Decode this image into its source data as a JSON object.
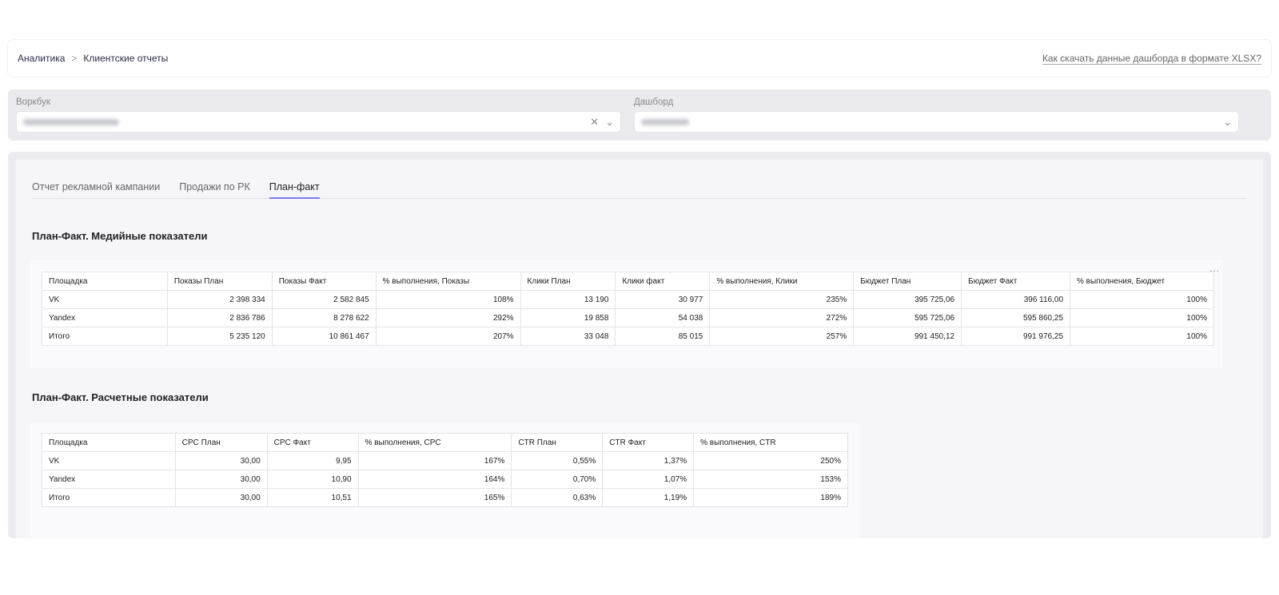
{
  "breadcrumb": {
    "items": [
      "Аналитика",
      "Клиентские отчеты"
    ],
    "separator": ">"
  },
  "help_link": "Как скачать данные дашборда в формате XLSX?",
  "filters": {
    "workbook_label": "Воркбук",
    "dashboard_label": "Дашборд"
  },
  "tabs": [
    "Отчет рекламной кампании",
    "Продажи по РК",
    "План-факт"
  ],
  "section1": {
    "title": "План-Факт. Медийные показатели",
    "headers": [
      "Площадка",
      "Показы План",
      "Показы Факт",
      "% выполнения, Показы",
      "Клики План",
      "Клики факт",
      "% выполнения, Клики",
      "Бюджет План",
      "Бюджет Факт",
      "% выполнения, Бюджет"
    ],
    "rows": [
      [
        "VK",
        "2 398 334",
        "2 582 845",
        "108%",
        "13 190",
        "30 977",
        "235%",
        "395 725,06",
        "396 116,00",
        "100%"
      ],
      [
        "Yandex",
        "2 836 786",
        "8 278 622",
        "292%",
        "19 858",
        "54 038",
        "272%",
        "595 725,06",
        "595 860,25",
        "100%"
      ],
      [
        "Итого",
        "5 235 120",
        "10 861 467",
        "207%",
        "33 048",
        "85 015",
        "257%",
        "991 450,12",
        "991 976,25",
        "100%"
      ]
    ]
  },
  "section2": {
    "title": "План-Факт. Расчетные показатели",
    "headers": [
      "Площадка",
      "CPC План",
      "CPC Факт",
      "% выполнения, CPC",
      "CTR План",
      "CTR Факт",
      "% выполнения, CTR"
    ],
    "rows": [
      [
        "VK",
        "30,00",
        "9,95",
        "167%",
        "0,55%",
        "1,37%",
        "250%"
      ],
      [
        "Yandex",
        "30,00",
        "10,90",
        "164%",
        "0,70%",
        "1,07%",
        "153%"
      ],
      [
        "Итого",
        "30,00",
        "10,51",
        "165%",
        "0,63%",
        "1,19%",
        "189%"
      ]
    ]
  },
  "more_label": "..."
}
